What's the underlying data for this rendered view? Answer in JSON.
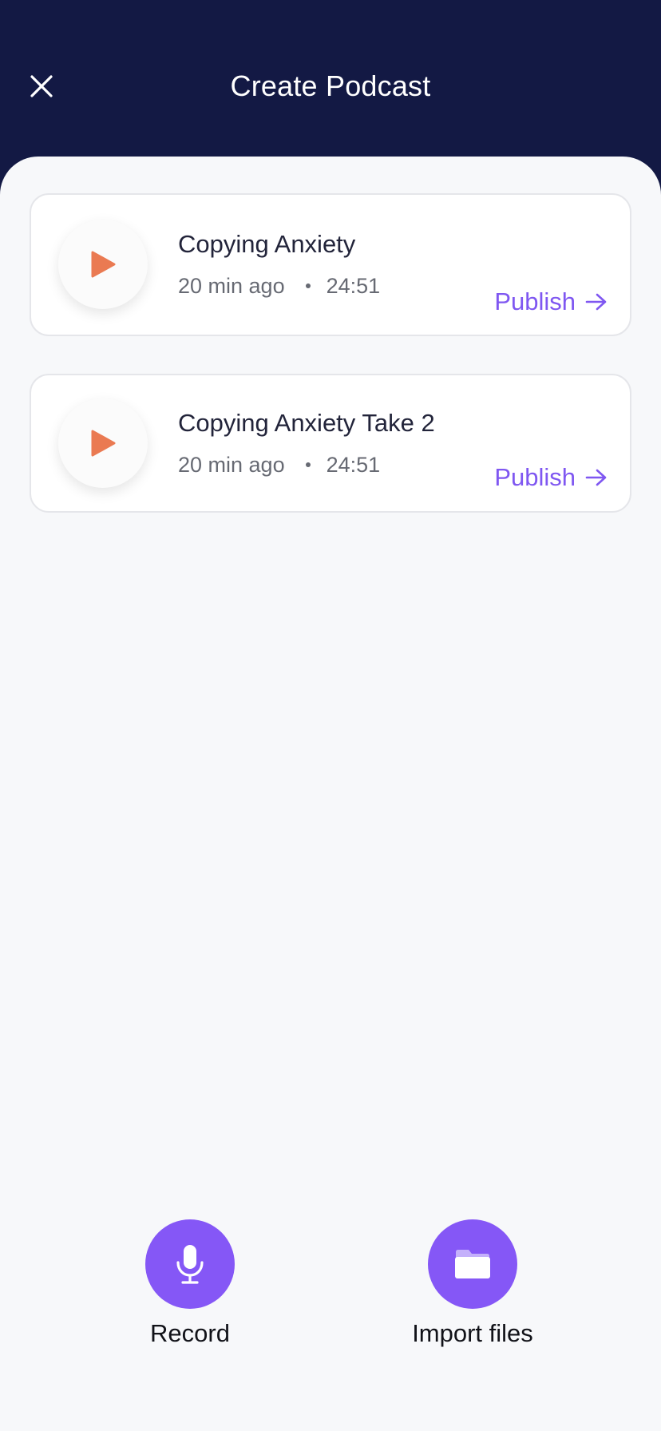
{
  "header": {
    "title": "Create Podcast",
    "close_icon": "close-icon"
  },
  "episodes": [
    {
      "title": "Copying Anxiety",
      "time_ago": "20 min ago",
      "duration": "24:51",
      "publish_label": "Publish"
    },
    {
      "title": "Copying Anxiety Take 2",
      "time_ago": "20 min ago",
      "duration": "24:51",
      "publish_label": "Publish"
    }
  ],
  "actions": {
    "record_label": "Record",
    "import_label": "Import files"
  },
  "colors": {
    "header_bg": "#131944",
    "sheet_bg": "#f7f8fa",
    "accent_purple": "#8557f6",
    "publish_purple": "#7f57f1",
    "play_orange": "#ea7a52"
  },
  "icons": {
    "play": "play-icon",
    "arrow": "arrow-right-icon",
    "mic": "microphone-icon",
    "folder": "folder-icon"
  }
}
